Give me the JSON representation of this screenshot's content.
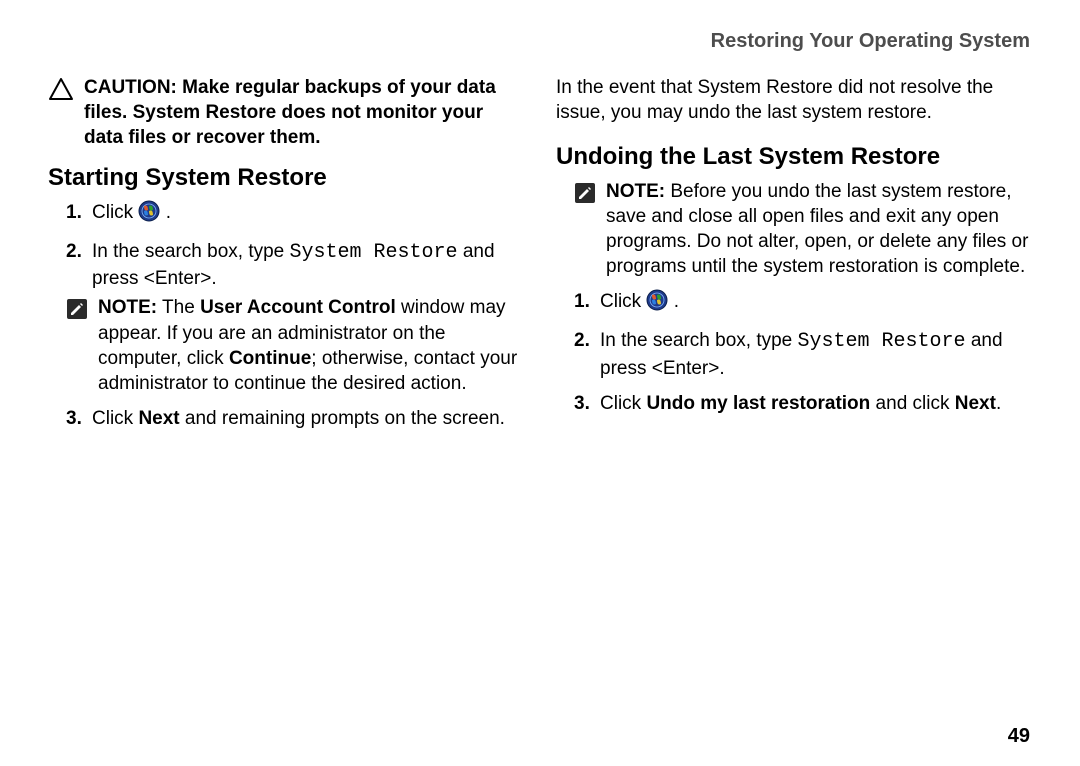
{
  "header": {
    "title": "Restoring Your Operating System"
  },
  "left": {
    "caution": {
      "label": "CAUTION:",
      "text": "Make regular backups of your data files. System Restore does not monitor your data files or recover them."
    },
    "section_title": "Starting System Restore",
    "step1_pre": "Click ",
    "step1_post": " .",
    "step2_pre": "In the search box, type ",
    "step2_mono": "System Restore",
    "step2_post": " and press <Enter>.",
    "note": {
      "label": "NOTE:",
      "pre": " The ",
      "bold1": "User Account Control",
      "mid": " window may appear. If you are an administrator on the computer, click ",
      "bold2": "Continue",
      "post": "; otherwise, contact your administrator to continue the desired action."
    },
    "step3_pre": "Click ",
    "step3_bold": "Next",
    "step3_post": " and remaining prompts on the screen."
  },
  "right": {
    "intro": "In the event that System Restore did not resolve the issue, you may undo the last system restore.",
    "section_title": "Undoing the Last System Restore",
    "note": {
      "label": "NOTE:",
      "text": " Before you undo the last system restore, save and close all open files and exit any open programs. Do not alter, open, or delete any files or programs until the system restoration is complete."
    },
    "step1_pre": "Click ",
    "step1_post": " .",
    "step2_pre": "In the search box, type ",
    "step2_mono": "System Restore",
    "step2_post": " and press <Enter>.",
    "step3_pre": "Click ",
    "step3_bold1": "Undo my last restoration",
    "step3_mid": " and click ",
    "step3_bold2": "Next",
    "step3_post": "."
  },
  "footer": {
    "page": "49"
  }
}
